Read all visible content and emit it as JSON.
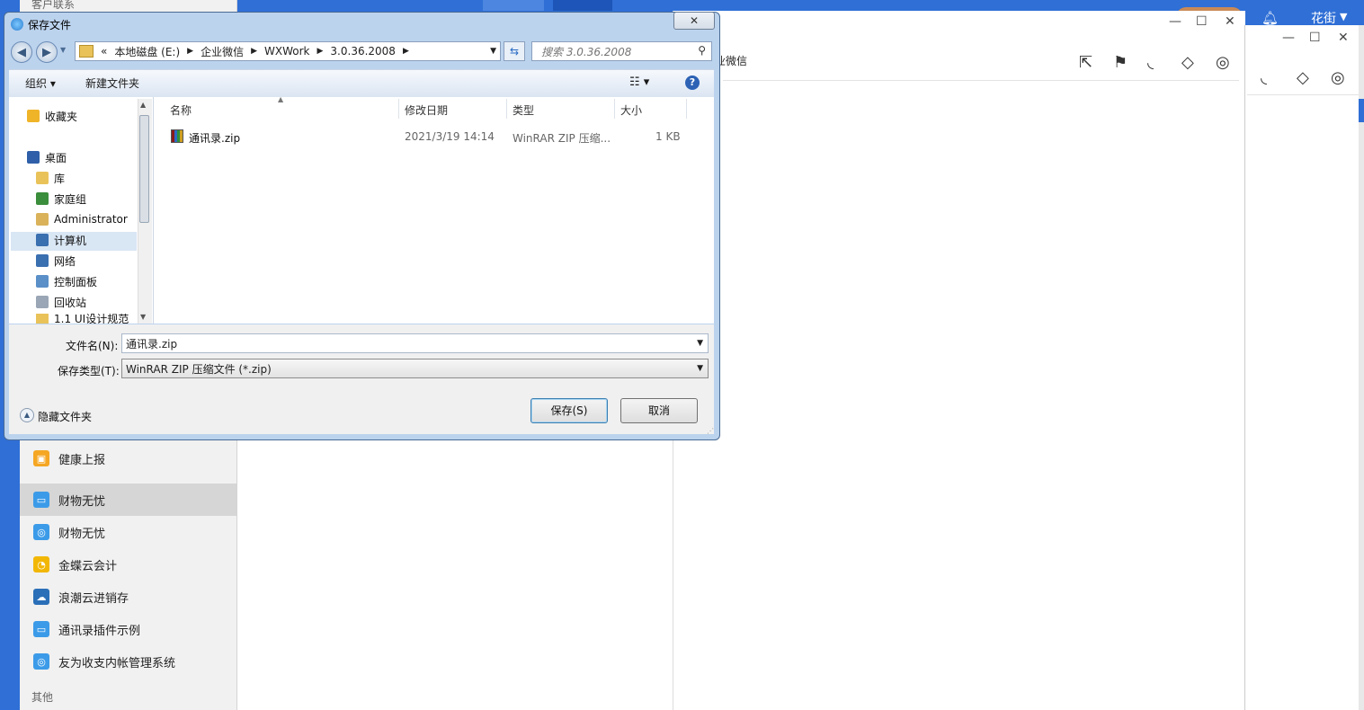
{
  "background_app": {
    "user_name": "花街",
    "category_top": "客户联系",
    "category_other": "其他",
    "sidebar_items": [
      {
        "label": "健康上报",
        "color": "#f5a623",
        "glyph": "▣"
      },
      {
        "label": "财物无忧",
        "color": "#3c9be8",
        "glyph": "▭"
      },
      {
        "label": "财物无忧",
        "color": "#3c9be8",
        "glyph": "◎"
      },
      {
        "label": "金蝶云会计",
        "color": "#f2b705",
        "glyph": "◔"
      },
      {
        "label": "浪潮云进销存",
        "color": "#2a6fb8",
        "glyph": "☁"
      },
      {
        "label": "通讯录插件示例",
        "color": "#3c9be8",
        "glyph": "▭"
      },
      {
        "label": "友为收支内帐管理系统",
        "color": "#3c9be8",
        "glyph": "◎"
      }
    ],
    "sub_window_text": "业微信"
  },
  "dialog": {
    "title": "保存文件",
    "close_glyph": "✕",
    "breadcrumb": {
      "prefix": "«",
      "items": [
        "本地磁盘 (E:)",
        "企业微信",
        "WXWork",
        "3.0.36.2008"
      ]
    },
    "search_placeholder": "搜索 3.0.36.2008",
    "toolbar": {
      "organize": "组织 ▾",
      "new_folder": "新建文件夹",
      "help": "?"
    },
    "nav_items": [
      {
        "label": "收藏夹",
        "icon": "favorites-star-icon",
        "color": "#f0b429"
      },
      {
        "label": "桌面",
        "icon": "desktop-icon",
        "color": "#2e5fa8"
      },
      {
        "label": "库",
        "icon": "library-icon",
        "color": "#e9c35a"
      },
      {
        "label": "家庭组",
        "icon": "homegroup-icon",
        "color": "#3b8e3b"
      },
      {
        "label": "Administrator",
        "icon": "user-folder-icon",
        "color": "#d9b25a"
      },
      {
        "label": "计算机",
        "icon": "computer-icon",
        "color": "#3a6fb0"
      },
      {
        "label": "网络",
        "icon": "network-icon",
        "color": "#3a6fb0"
      },
      {
        "label": "控制面板",
        "icon": "control-panel-icon",
        "color": "#5a8fc8"
      },
      {
        "label": "回收站",
        "icon": "recycle-bin-icon",
        "color": "#9aa6b5"
      },
      {
        "label": "1.1 UI设计规范",
        "icon": "folder-icon",
        "color": "#e9c35a"
      }
    ],
    "columns": {
      "name": "名称",
      "date": "修改日期",
      "type": "类型",
      "size": "大小"
    },
    "files": [
      {
        "name": "通讯录.zip",
        "date": "2021/3/19 14:14",
        "type": "WinRAR ZIP 压缩...",
        "size": "1 KB"
      }
    ],
    "filename_label": "文件名(N):",
    "filename_value": "通讯录.zip",
    "filetype_label": "保存类型(T):",
    "filetype_value": "WinRAR ZIP 压缩文件 (*.zip)",
    "hide_folders": "隐藏文件夹",
    "save_button": "保存(S)",
    "cancel_button": "取消"
  }
}
